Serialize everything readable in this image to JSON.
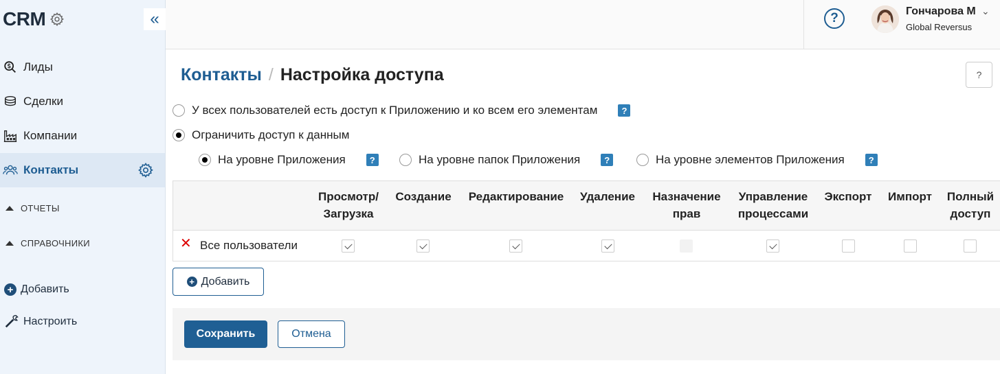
{
  "sidebar": {
    "logo": "CRM",
    "collapse_glyph": "«",
    "items": [
      {
        "label": "Лиды",
        "icon": "search-dollar-icon"
      },
      {
        "label": "Сделки",
        "icon": "coins-icon"
      },
      {
        "label": "Компании",
        "icon": "factory-icon"
      },
      {
        "label": "Контакты",
        "icon": "users-icon",
        "active": true
      }
    ],
    "groups": [
      "ОТЧЕТЫ",
      "СПРАВОЧНИКИ"
    ],
    "add_label": "Добавить",
    "configure_label": "Настроить"
  },
  "header": {
    "help_glyph": "?",
    "user_name": "Гончарова М",
    "user_org": "Global Reversus"
  },
  "page": {
    "crumb": "Контакты",
    "separator": "/",
    "title": "Настройка доступа",
    "help_glyph": "?"
  },
  "access": {
    "option_all": "У всех пользователей есть доступ к Приложению и ко всем его элементам",
    "option_restrict": "Ограничить доступ к данным",
    "level_app": "На уровне Приложения",
    "level_folders": "На уровне папок Приложения",
    "level_elements": "На уровне элементов Приложения",
    "badge": "?"
  },
  "table": {
    "columns": [
      [
        "Просмотр/",
        "Загрузка"
      ],
      [
        "Создание",
        ""
      ],
      [
        "Редактирование",
        ""
      ],
      [
        "Удаление",
        ""
      ],
      [
        "Назначение",
        "прав"
      ],
      [
        "Управление",
        "процессами"
      ],
      [
        "Экспорт",
        ""
      ],
      [
        "Импорт",
        ""
      ],
      [
        "Полный",
        "доступ"
      ]
    ],
    "rows": [
      {
        "remove_glyph": "✕",
        "label": "Все пользователи",
        "values": [
          "checked",
          "checked",
          "checked",
          "checked",
          "disabled",
          "checked",
          "unchecked",
          "unchecked",
          "unchecked"
        ]
      }
    ]
  },
  "actions": {
    "add_label": "Добавить",
    "save_label": "Сохранить",
    "cancel_label": "Отмена"
  },
  "colors": {
    "accent": "#1e5d92",
    "sidebar_bg": "#eef4fb",
    "badge": "#2f7fb8",
    "remove": "#dd0000"
  }
}
